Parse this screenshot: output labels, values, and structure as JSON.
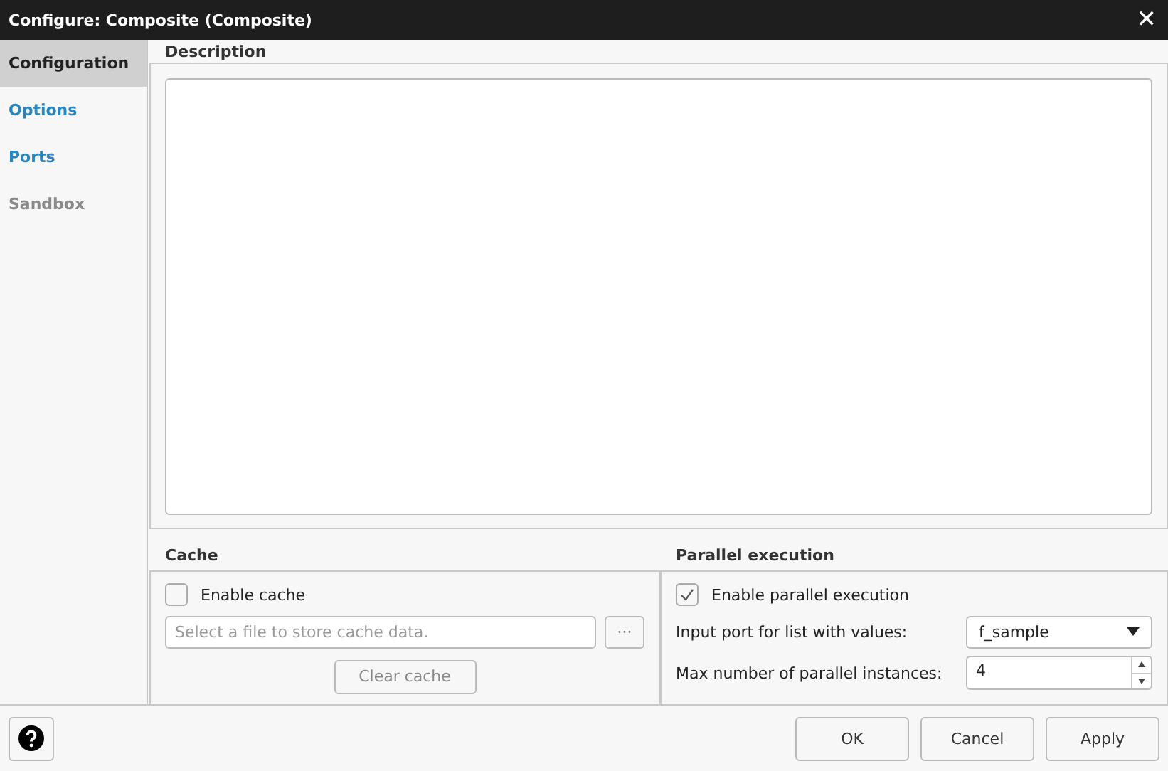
{
  "window": {
    "title": "Configure: Composite (Composite)",
    "close": "✕"
  },
  "sidebar": {
    "items": [
      {
        "label": "Configuration",
        "selected": true,
        "disabled": false
      },
      {
        "label": "Options",
        "selected": false,
        "disabled": false
      },
      {
        "label": "Ports",
        "selected": false,
        "disabled": false
      },
      {
        "label": "Sandbox",
        "selected": false,
        "disabled": true
      }
    ]
  },
  "description": {
    "label": "Description"
  },
  "cache": {
    "label": "Cache",
    "enable": {
      "label": "Enable cache",
      "checked": false
    },
    "file": {
      "placeholder": "Select a file to store cache data.",
      "browse": "···"
    },
    "clear": {
      "label": "Clear cache",
      "disabled": true
    }
  },
  "parallel": {
    "label": "Parallel execution",
    "enable": {
      "label": "Enable parallel execution",
      "checked": true
    },
    "port": {
      "label": "Input port for list with values:",
      "value": "f_sample"
    },
    "instances": {
      "label": "Max number of parallel instances:",
      "value": "4"
    }
  },
  "buttons": [
    "OK",
    "Cancel",
    "Apply"
  ]
}
